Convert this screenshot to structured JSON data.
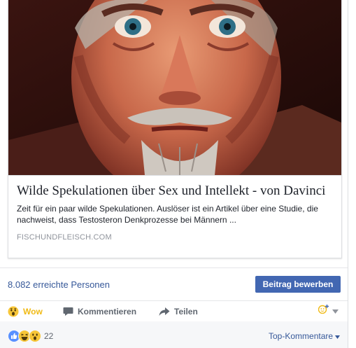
{
  "link_card": {
    "title": "Wilde Spekulationen über Sex und Intellekt - von Davinci",
    "description": "Zeit für ein paar wilde Spekulationen. Auslöser ist ein Artikel über eine Studie, die nachweist, dass Testosteron Denkprozesse bei Männern ...",
    "domain": "FISCHUNDFLEISCH.COM"
  },
  "stats": {
    "reach_text": "8.082 erreichte Personen",
    "promote_label": "Beitrag bewerben"
  },
  "actions": {
    "wow_label": "Wow",
    "comment_label": "Kommentieren",
    "share_label": "Teilen"
  },
  "summary": {
    "reaction_count": "22",
    "sort_label": "Top-Kommentare"
  },
  "colors": {
    "link_blue": "#365899",
    "button_blue": "#4267b2",
    "wow_yellow": "#f0ba15",
    "like_blue": "#5890ff"
  },
  "icons": [
    "wow-reaction-icon",
    "comment-icon",
    "share-icon",
    "reaction-picker-icon",
    "like-reaction-icon",
    "haha-reaction-icon",
    "wow-reaction-icon",
    "caret-down-icon"
  ]
}
